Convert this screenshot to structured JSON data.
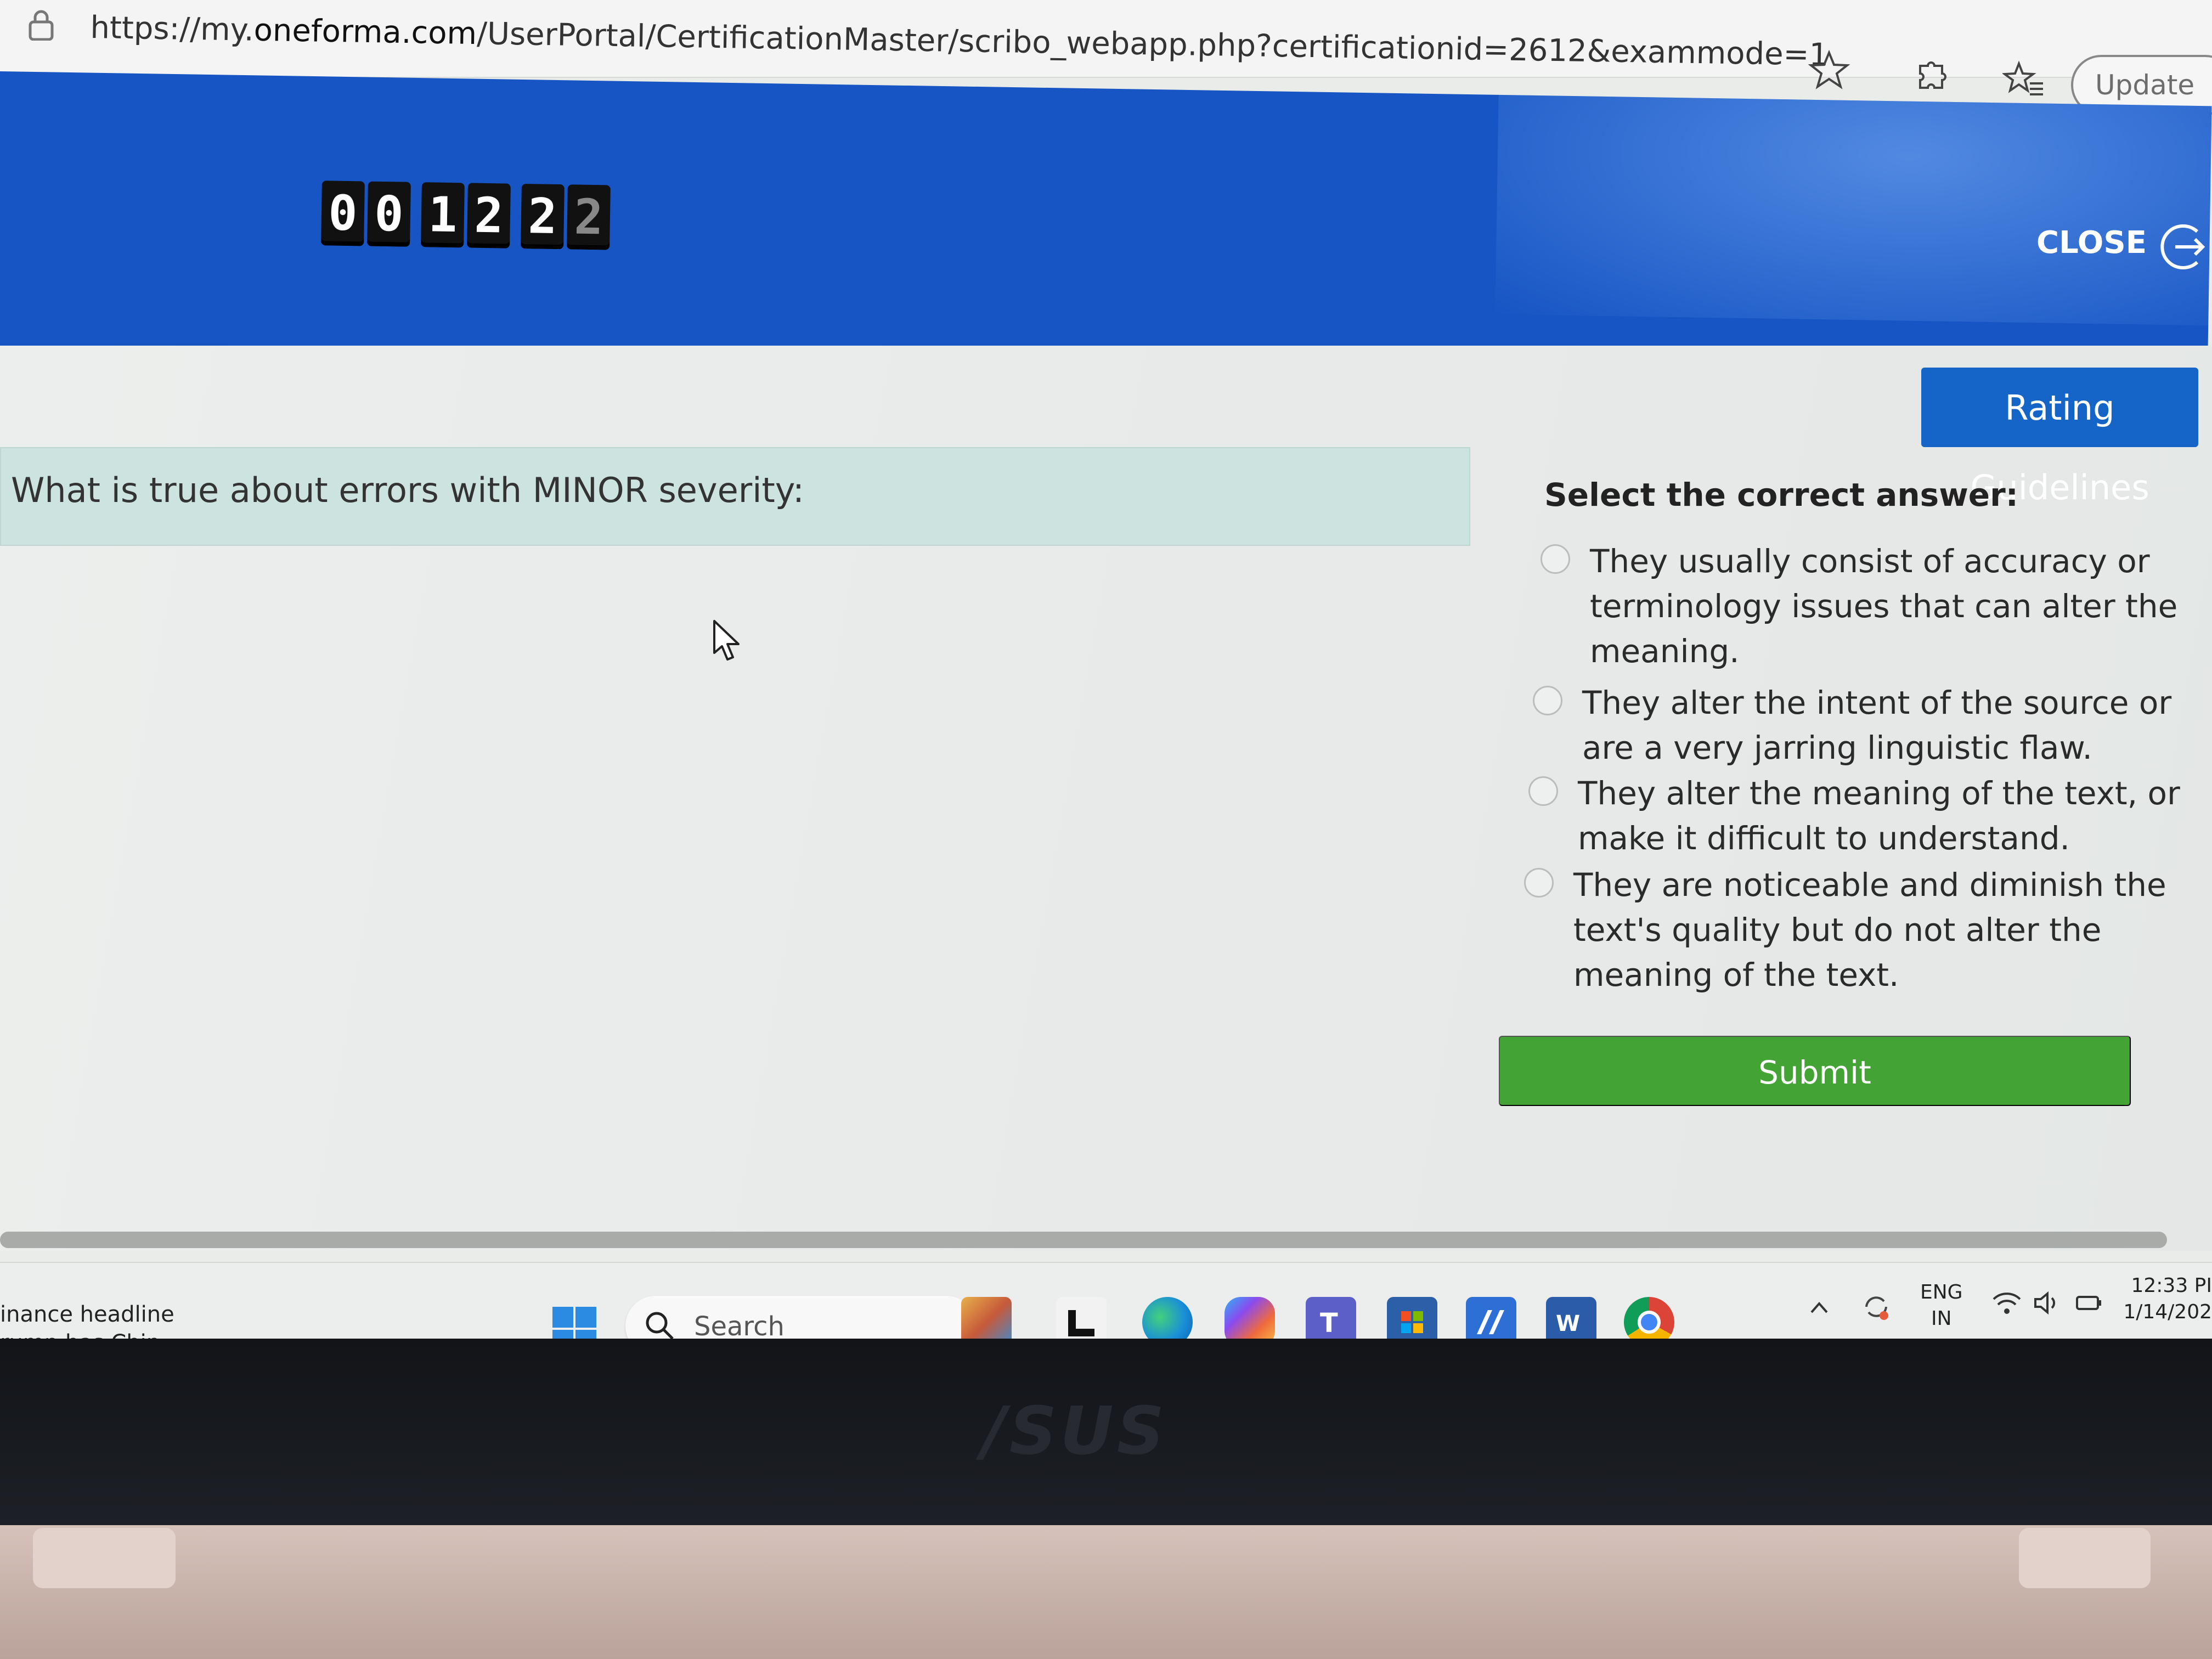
{
  "browser": {
    "url_prefix": "https://my.",
    "url_host": "oneforma.com",
    "url_path": "/UserPortal/CertificationMaster/scribo_webapp.php?certificationid=2612&exammode=1",
    "update_label": "Update"
  },
  "exam": {
    "timer_digits": [
      "0",
      "0",
      "1",
      "2",
      "2",
      "2"
    ],
    "close_label": "CLOSE",
    "guidelines_label": "Rating Guidelines",
    "question": "What is true about errors with MINOR severity:",
    "answer_heading": "Select the correct answer:",
    "options": [
      {
        "label": "They usually consist of accuracy or terminology issues that can alter the meaning.",
        "selected": false
      },
      {
        "label": "They alter the intent of the source or are a very jarring linguistic flaw.",
        "selected": false
      },
      {
        "label": "They alter the meaning of the text, or make it difficult to understand.",
        "selected": false
      },
      {
        "label": "They are noticeable and diminish the text's quality but do not alter the meaning of the text.",
        "selected": false
      }
    ],
    "submit_label": "Submit"
  },
  "taskbar": {
    "news_line1": "inance headline",
    "news_line2": "rump has Chin...",
    "search_label": "Search",
    "apps": [
      "windows-store-cube-icon",
      "l-app-icon",
      "edge-icon",
      "copilot-icon",
      "teams-icon",
      "microsoft-store-icon",
      "mya-icon",
      "word-icon",
      "chrome-icon"
    ],
    "language_top": "ENG",
    "language_bottom": "IN",
    "time": "12:33 PI",
    "date": "1/14/202"
  },
  "device": {
    "brand": "/SUS"
  },
  "colors": {
    "banner": "#1755c4",
    "guidelines_button": "#1565c8",
    "question_bg": "#cde3df",
    "submit": "#43a334"
  }
}
